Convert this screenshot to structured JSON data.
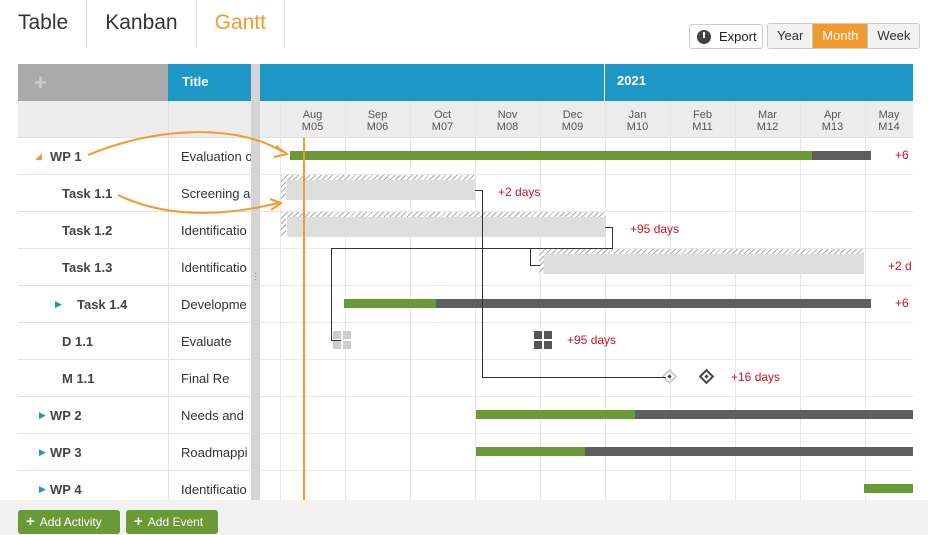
{
  "tabs": [
    {
      "label": "Table"
    },
    {
      "label": "Kanban"
    },
    {
      "label": "Gantt",
      "active": true
    }
  ],
  "toolbar": {
    "export_label": "Export",
    "scale": [
      "Year",
      "Month",
      "Week"
    ],
    "scale_selected": "Month"
  },
  "grid": {
    "add_symbol": "+",
    "title_header": "Title",
    "year_label": "2021"
  },
  "months": [
    {
      "name": "Aug",
      "code": "M05"
    },
    {
      "name": "Sep",
      "code": "M06"
    },
    {
      "name": "Oct",
      "code": "M07"
    },
    {
      "name": "Nov",
      "code": "M08"
    },
    {
      "name": "Dec",
      "code": "M09"
    },
    {
      "name": "Jan",
      "code": "M10"
    },
    {
      "name": "Feb",
      "code": "M11"
    },
    {
      "name": "Mar",
      "code": "M12"
    },
    {
      "name": "Apr",
      "code": "M13"
    },
    {
      "name": "May",
      "code": "M14"
    }
  ],
  "rows": [
    {
      "code": "WP 1",
      "title": "Evaluation o",
      "late": "+6"
    },
    {
      "code": "Task 1.1",
      "title": "Screening a",
      "late": "+2 days"
    },
    {
      "code": "Task 1.2",
      "title": "Identificatio",
      "late": "+95 days"
    },
    {
      "code": "Task 1.3",
      "title": "Identificatio",
      "late": "+2 d"
    },
    {
      "code": "Task 1.4",
      "title": "Developme",
      "late": "+6"
    },
    {
      "code": "D 1.1",
      "title": "Evaluate",
      "late": "+95 days"
    },
    {
      "code": "M 1.1",
      "title": "Final Re",
      "late": "+16 days"
    },
    {
      "code": "WP 2",
      "title": "Needs and"
    },
    {
      "code": "WP 3",
      "title": "Roadmappi"
    },
    {
      "code": "WP 4",
      "title": "Identificatio"
    }
  ],
  "footer": {
    "add_activity": "Add Activity",
    "add_event": "Add Event"
  },
  "colors": {
    "accent": "#f39a2e",
    "header": "#1c97c6",
    "progress": "#6a9a35",
    "remaining": "#5e5e5e",
    "late": "#d0111b"
  }
}
